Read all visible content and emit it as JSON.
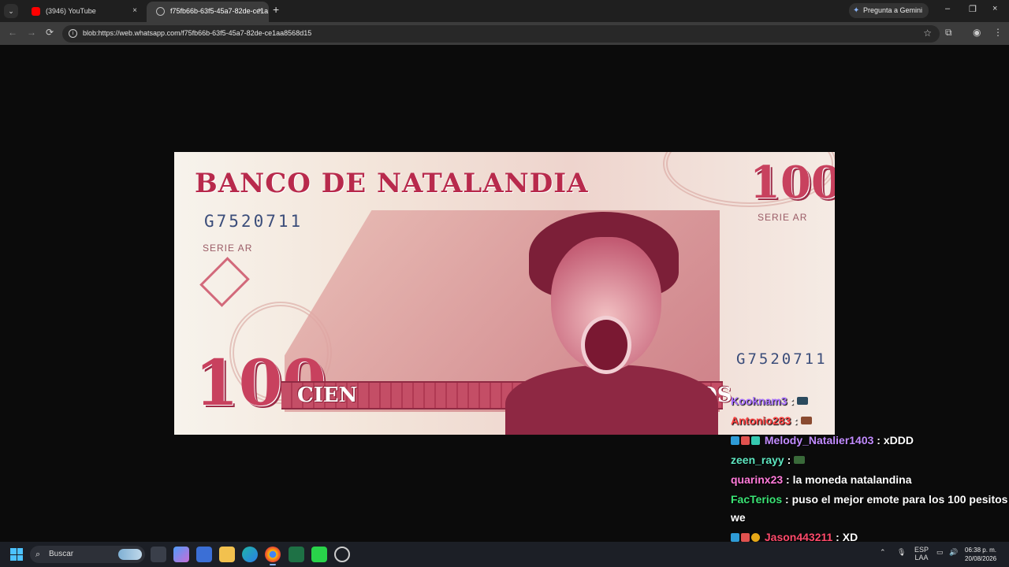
{
  "browser": {
    "tabs": [
      {
        "title": "(3946) YouTube",
        "close": "×"
      },
      {
        "title": "f75fb66b-63f5-45a7-82de-ce1a",
        "close": "×"
      }
    ],
    "new_tab": "+",
    "tab_menu": "⌄",
    "gemini_label": "Pregunta a Gemini",
    "window_controls": {
      "minimize": "–",
      "maximize": "❐",
      "close": "×"
    },
    "url": "blob:https://web.whatsapp.com/f75fb66b-63f5-45a7-82de-ce1aa8568d15",
    "nav": {
      "back": "←",
      "forward": "→",
      "reload": "⟳"
    }
  },
  "banknote": {
    "title": "BANCO DE NATALANDIA",
    "serial_top": "G7520711",
    "serial_bottom": "G7520711",
    "series_left": "SERIE AR",
    "series_right": "SERIE AR",
    "denomination_top": "100",
    "denomination_bottom": "100",
    "word_left": "CIEN",
    "word_right": "PESOS"
  },
  "chat": [
    {
      "user": "Kooknam3",
      "message": "",
      "color": "#a970ff",
      "emote": true
    },
    {
      "user": "Antonio283",
      "message": "",
      "color": "#ff4040",
      "emote": true
    },
    {
      "user": "Melody_Natalier1403",
      "message": "xDDD",
      "color": "#c28cff",
      "badges": 3
    },
    {
      "user": "zeen_rayy",
      "message": "",
      "color": "#5ee6c0",
      "emote": true
    },
    {
      "user": "quarinx23",
      "message": "la moneda natalandina",
      "color": "#ff7ad9"
    },
    {
      "user": "FacTerios",
      "message": "puso el mejor emote para los 100 pesitos",
      "color": "#3ae374"
    },
    {
      "user": "",
      "message": "we",
      "color": "#ffffff"
    },
    {
      "user": "Jason443211",
      "message": "XD",
      "color": "#ff4a6b",
      "badges": 3
    }
  ],
  "taskbar": {
    "search_placeholder": "Buscar",
    "lang_top": "ESP",
    "lang_bottom": "LAA",
    "time": "06:38 p. m.",
    "date": "20/08/2026"
  }
}
